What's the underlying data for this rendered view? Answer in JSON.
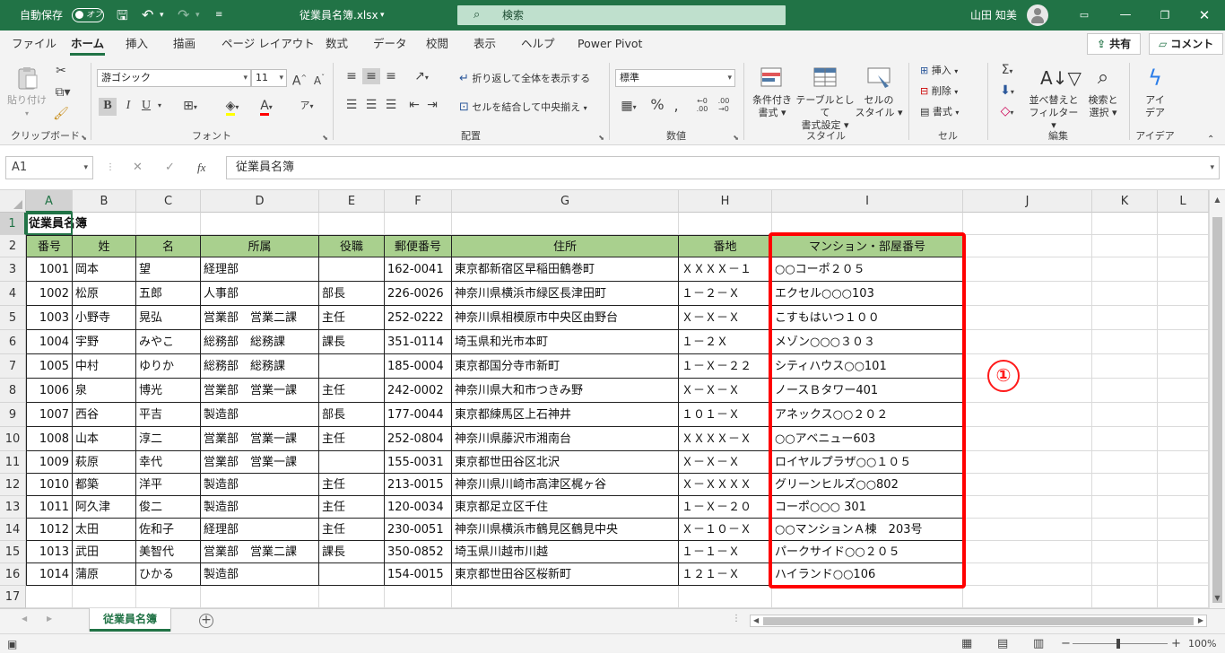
{
  "titlebar": {
    "autosave": "自動保存",
    "toggle_state": "オフ",
    "filename": "従業員名簿.xlsx",
    "search_placeholder": "検索",
    "user": "山田 知美"
  },
  "tabs": [
    "ファイル",
    "ホーム",
    "挿入",
    "描画",
    "ページ レイアウト",
    "数式",
    "データ",
    "校閲",
    "表示",
    "ヘルプ",
    "Power Pivot"
  ],
  "active_tab": "ホーム",
  "share_label": "共有",
  "comment_label": "コメント",
  "ribbon": {
    "clipboard": {
      "paste": "貼り付け",
      "label": "クリップボード"
    },
    "font": {
      "name": "游ゴシック",
      "size": "11",
      "label": "フォント"
    },
    "alignment": {
      "wrap": "折り返して全体を表示する",
      "merge": "セルを結合して中央揃え",
      "label": "配置"
    },
    "number": {
      "format": "標準",
      "label": "数値"
    },
    "styles": {
      "conditional": [
        "条件付き",
        "書式"
      ],
      "table": [
        "テーブルとして",
        "書式設定"
      ],
      "cell": [
        "セルの",
        "スタイル"
      ],
      "label": "スタイル"
    },
    "cells": {
      "insert": "挿入",
      "delete": "削除",
      "format": "書式",
      "label": "セル"
    },
    "editing": {
      "sort": [
        "並べ替えと",
        "フィルター"
      ],
      "find": [
        "検索と",
        "選択"
      ],
      "label": "編集"
    },
    "ideas": {
      "btn": [
        "アイ",
        "デア"
      ],
      "label": "アイデア"
    }
  },
  "formula_bar": {
    "cell_ref": "A1",
    "fx": "fx",
    "value": "従業員名簿"
  },
  "columns": [
    "A",
    "B",
    "C",
    "D",
    "E",
    "F",
    "G",
    "H",
    "I",
    "J",
    "K",
    "L"
  ],
  "rows": [
    "1",
    "2",
    "3",
    "4",
    "5",
    "6",
    "7",
    "8",
    "9",
    "10",
    "11",
    "12",
    "13",
    "14",
    "15",
    "16",
    "17"
  ],
  "sheet_title": "従業員名簿",
  "table_headers": [
    "番号",
    "姓",
    "名",
    "所属",
    "役職",
    "郵便番号",
    "住所",
    "番地",
    "マンション・部屋番号"
  ],
  "table_rows": [
    [
      "1001",
      "岡本",
      "望",
      "経理部",
      "",
      "162-0041",
      "東京都新宿区早稲田鶴巻町",
      "ＸＸＸＸ－１",
      "○○コーポ２０５"
    ],
    [
      "1002",
      "松原",
      "五郎",
      "人事部",
      "部長",
      "226-0026",
      "神奈川県横浜市緑区長津田町",
      "１－２－Ｘ",
      "エクセル○○○103"
    ],
    [
      "1003",
      "小野寺",
      "晃弘",
      "営業部　営業二課",
      "主任",
      "252-0222",
      "神奈川県相模原市中央区由野台",
      "Ｘ－Ｘ－Ｘ",
      "こすもはいつ１００"
    ],
    [
      "1004",
      "宇野",
      "みやこ",
      "総務部　総務課",
      "課長",
      "351-0114",
      "埼玉県和光市本町",
      "１－２Ｘ",
      "メゾン○○○３０３"
    ],
    [
      "1005",
      "中村",
      "ゆりか",
      "総務部　総務課",
      "",
      "185-0004",
      "東京都国分寺市新町",
      "１－Ｘ－２２",
      "シティハウス○○101"
    ],
    [
      "1006",
      "泉",
      "博光",
      "営業部　営業一課",
      "主任",
      "242-0002",
      "神奈川県大和市つきみ野",
      "Ｘ－Ｘ－Ｘ",
      "ノースＢタワー401"
    ],
    [
      "1007",
      "西谷",
      "平吉",
      "製造部",
      "部長",
      "177-0044",
      "東京都練馬区上石神井",
      "１０１－Ｘ",
      "アネックス○○２０２"
    ],
    [
      "1008",
      "山本",
      "淳二",
      "営業部　営業一課",
      "主任",
      "252-0804",
      "神奈川県藤沢市湘南台",
      "ＸＸＸＸ－Ｘ",
      "○○アベニュー603"
    ],
    [
      "1009",
      "萩原",
      "幸代",
      "営業部　営業一課",
      "",
      "155-0031",
      "東京都世田谷区北沢",
      "Ｘ－Ｘ－Ｘ",
      "ロイヤルプラザ○○１０５"
    ],
    [
      "1010",
      "都築",
      "洋平",
      "製造部",
      "主任",
      "213-0015",
      "神奈川県川崎市高津区梶ヶ谷",
      "Ｘ－ＸＸＸＸ",
      "グリーンヒルズ○○802"
    ],
    [
      "1011",
      "阿久津",
      "俊二",
      "製造部",
      "主任",
      "120-0034",
      "東京都足立区千住",
      "１－Ｘ－２０",
      "コーポ○○○ 301"
    ],
    [
      "1012",
      "太田",
      "佐和子",
      "経理部",
      "主任",
      "230-0051",
      "神奈川県横浜市鶴見区鶴見中央",
      "Ｘ－１０－Ｘ",
      "○○マンションＡ棟　203号"
    ],
    [
      "1013",
      "武田",
      "美智代",
      "営業部　営業二課",
      "課長",
      "350-0852",
      "埼玉県川越市川越",
      "１－１－Ｘ",
      "パークサイド○○２０５"
    ],
    [
      "1014",
      "蒲原",
      "ひかる",
      "製造部",
      "",
      "154-0015",
      "東京都世田谷区桜新町",
      "１２１－Ｘ",
      "ハイランド○○106"
    ]
  ],
  "annotation": "①",
  "sheet_tab": "従業員名簿",
  "zoom": "100%",
  "colors": {
    "accent": "#217346",
    "header_fill": "#a9d08e",
    "highlight": "#ff0000"
  }
}
